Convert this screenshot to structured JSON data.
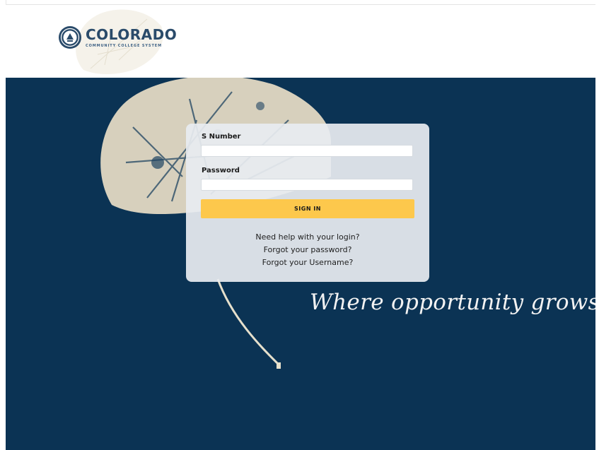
{
  "brand": {
    "name": "COLORADO",
    "subtitle": "COMMUNITY COLLEGE SYSTEM",
    "logo_icon": "state-seal-icon",
    "colors": {
      "navy": "#0b3354",
      "logo_blue": "#2a4b6a",
      "button_gold": "#fdc84c"
    }
  },
  "login": {
    "username_label": "S Number",
    "username_value": "",
    "password_label": "Password",
    "password_value": "",
    "signin_label": "SIGN IN",
    "links": [
      "Need help with your login?",
      "Forgot your password?",
      "Forgot your Username?"
    ]
  },
  "tagline": "Where opportunity grows."
}
